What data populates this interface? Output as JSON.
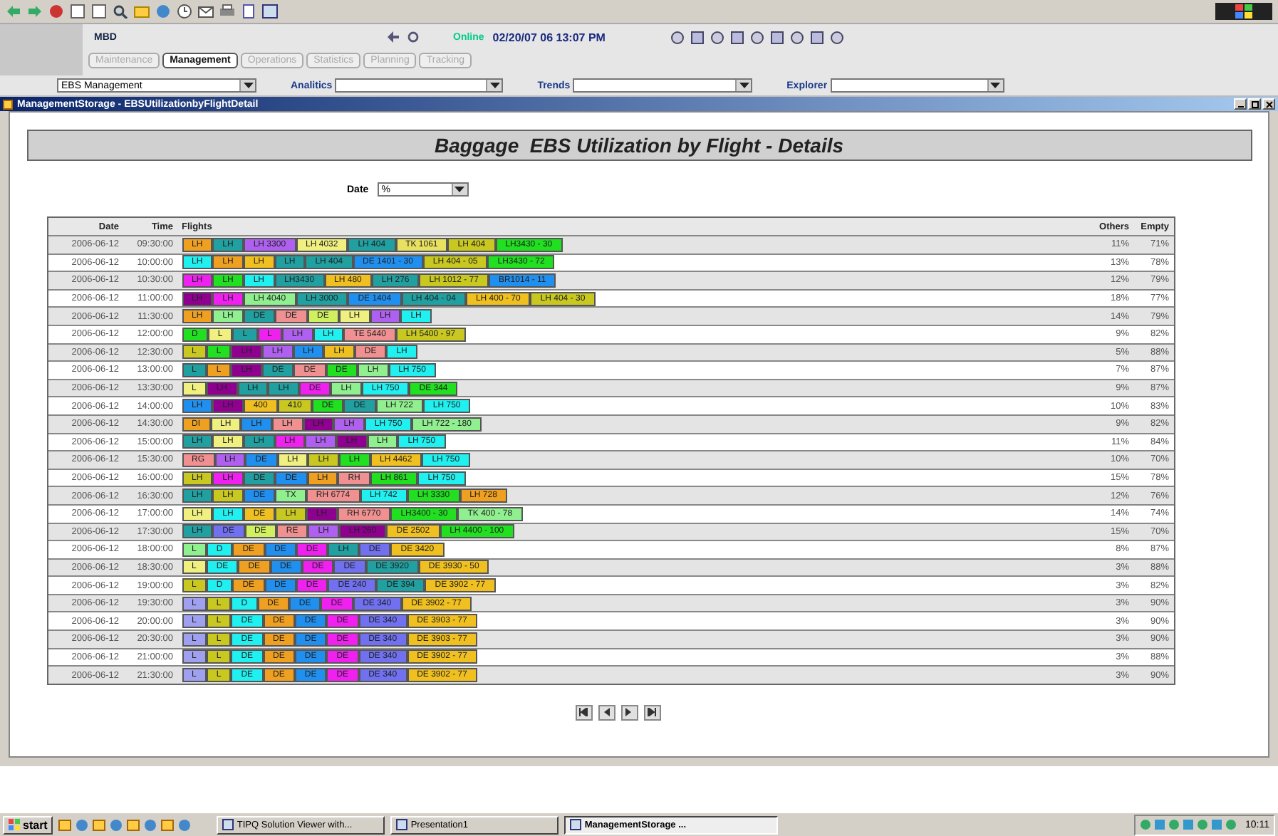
{
  "header": {
    "user": "MBD",
    "status": "Online",
    "timestamp": "02/20/07 06 13:07 PM",
    "tabs": [
      {
        "label": "Maintenance",
        "selected": false
      },
      {
        "label": "Management",
        "selected": true
      },
      {
        "label": "Operations",
        "selected": false
      },
      {
        "label": "Statistics",
        "selected": false
      },
      {
        "label": "Planning",
        "selected": false
      },
      {
        "label": "Tracking",
        "selected": false
      }
    ]
  },
  "filters": [
    {
      "value": "EBS Management"
    },
    {
      "label": "Analitics"
    },
    {
      "label": "Trends"
    },
    {
      "label": "Explorer"
    }
  ],
  "window": {
    "title": "ManagementStorage - EBSUtilizationbyFlightDetail"
  },
  "report": {
    "title": "Baggage  EBS Utilization by Flight - Details",
    "date_filter": {
      "label": "Date",
      "value": "%"
    },
    "table": {
      "columns": [
        "Date",
        "Time",
        "Flights",
        "Others",
        "Empty"
      ],
      "rows": [
        {
          "date": "2006-06-12",
          "time": "09:30:00",
          "others": "11%",
          "empty": "71%",
          "flights": [
            {
              "label": "LH",
              "color": "#f0a020"
            },
            {
              "label": "LH",
              "color": "#20a0a0"
            },
            {
              "label": "LH 3300",
              "color": "#b060f0"
            },
            {
              "label": "LH 4032",
              "color": "#f0f080"
            },
            {
              "label": "LH 404",
              "color": "#20a0a0"
            },
            {
              "label": "TK 1061",
              "color": "#e8e060"
            },
            {
              "label": "LH 404",
              "color": "#c8c820"
            },
            {
              "label": "LH3430 - 30",
              "color": "#20e020"
            }
          ]
        },
        {
          "date": "2006-06-12",
          "time": "10:00:00",
          "others": "13%",
          "empty": "78%",
          "flights": [
            {
              "label": "LH",
              "color": "#20f0f0"
            },
            {
              "label": "LH",
              "color": "#f0a020"
            },
            {
              "label": "LH",
              "color": "#f0c020"
            },
            {
              "label": "LH",
              "color": "#20a0a0"
            },
            {
              "label": "LH 404",
              "color": "#20a0a0"
            },
            {
              "label": "DE 1401 - 30",
              "color": "#2090f0"
            },
            {
              "label": "LH 404 - 05",
              "color": "#c8c820"
            },
            {
              "label": "LH3430 - 72",
              "color": "#20e020"
            }
          ]
        },
        {
          "date": "2006-06-12",
          "time": "10:30:00",
          "others": "12%",
          "empty": "79%",
          "flights": [
            {
              "label": "LH",
              "color": "#f020f0"
            },
            {
              "label": "LH",
              "color": "#20e020"
            },
            {
              "label": "LH",
              "color": "#20f0f0"
            },
            {
              "label": "LH3430",
              "color": "#20a0a0"
            },
            {
              "label": "LH 480",
              "color": "#f0c020"
            },
            {
              "label": "LH 276",
              "color": "#20a0a0"
            },
            {
              "label": "LH 1012 - 77",
              "color": "#c8c820"
            },
            {
              "label": "BR1014 - 11",
              "color": "#2090f0"
            }
          ]
        },
        {
          "date": "2006-06-12",
          "time": "11:00:00",
          "others": "18%",
          "empty": "77%",
          "flights": [
            {
              "label": "LH",
              "color": "#900090"
            },
            {
              "label": "LH",
              "color": "#f020f0"
            },
            {
              "label": "LH 4040",
              "color": "#90f090"
            },
            {
              "label": "LH 3000",
              "color": "#20a0a0"
            },
            {
              "label": "DE 1404",
              "color": "#2090f0"
            },
            {
              "label": "LH 404 - 04",
              "color": "#20a0a0"
            },
            {
              "label": "LH 400 - 70",
              "color": "#f0c020"
            },
            {
              "label": "LH 404 - 30",
              "color": "#c8c820"
            }
          ]
        },
        {
          "date": "2006-06-12",
          "time": "11:30:00",
          "others": "14%",
          "empty": "79%",
          "flights": [
            {
              "label": "LH",
              "color": "#f0a020"
            },
            {
              "label": "LH",
              "color": "#90f090"
            },
            {
              "label": "DE",
              "color": "#20a0a0"
            },
            {
              "label": "DE",
              "color": "#f09090"
            },
            {
              "label": "DE",
              "color": "#d0f060"
            },
            {
              "label": "LH",
              "color": "#f0f080"
            },
            {
              "label": "LH",
              "color": "#b060f0"
            },
            {
              "label": "LH",
              "color": "#20f0f0"
            }
          ]
        },
        {
          "date": "2006-06-12",
          "time": "12:00:00",
          "others": "9%",
          "empty": "82%",
          "flights": [
            {
              "label": "D",
              "color": "#20e020"
            },
            {
              "label": "L",
              "color": "#f0f080"
            },
            {
              "label": "L",
              "color": "#20a0a0"
            },
            {
              "label": "L",
              "color": "#f020f0"
            },
            {
              "label": "LH",
              "color": "#b060f0"
            },
            {
              "label": "LH",
              "color": "#20f0f0"
            },
            {
              "label": "TE 5440",
              "color": "#f09090"
            },
            {
              "label": "LH 5400 - 97",
              "color": "#c8c820"
            }
          ]
        },
        {
          "date": "2006-06-12",
          "time": "12:30:00",
          "others": "5%",
          "empty": "88%",
          "flights": [
            {
              "label": "L",
              "color": "#c8c820"
            },
            {
              "label": "L",
              "color": "#20e020"
            },
            {
              "label": "LH",
              "color": "#900090"
            },
            {
              "label": "LH",
              "color": "#b060f0"
            },
            {
              "label": "LH",
              "color": "#2090f0"
            },
            {
              "label": "LH",
              "color": "#f0c020"
            },
            {
              "label": "DE",
              "color": "#f09090"
            },
            {
              "label": "LH",
              "color": "#20f0f0"
            }
          ]
        },
        {
          "date": "2006-06-12",
          "time": "13:00:00",
          "others": "7%",
          "empty": "87%",
          "flights": [
            {
              "label": "L",
              "color": "#20a0a0"
            },
            {
              "label": "L",
              "color": "#f0a020"
            },
            {
              "label": "LH",
              "color": "#900090"
            },
            {
              "label": "DE",
              "color": "#20a0a0"
            },
            {
              "label": "DE",
              "color": "#f09090"
            },
            {
              "label": "DE",
              "color": "#20e020"
            },
            {
              "label": "LH",
              "color": "#90f090"
            },
            {
              "label": "LH 750",
              "color": "#20f0f0"
            }
          ]
        },
        {
          "date": "2006-06-12",
          "time": "13:30:00",
          "others": "9%",
          "empty": "87%",
          "flights": [
            {
              "label": "L",
              "color": "#f0f080"
            },
            {
              "label": "LH",
              "color": "#900090"
            },
            {
              "label": "LH",
              "color": "#20a0a0"
            },
            {
              "label": "LH",
              "color": "#20a0a0"
            },
            {
              "label": "DE",
              "color": "#f020f0"
            },
            {
              "label": "LH",
              "color": "#90f090"
            },
            {
              "label": "LH 750",
              "color": "#20f0f0"
            },
            {
              "label": "DE 344",
              "color": "#20e020"
            }
          ]
        },
        {
          "date": "2006-06-12",
          "time": "14:00:00",
          "others": "10%",
          "empty": "83%",
          "flights": [
            {
              "label": "LH",
              "color": "#2090f0"
            },
            {
              "label": "LH",
              "color": "#900090"
            },
            {
              "label": "400",
              "color": "#f0c020"
            },
            {
              "label": "410",
              "color": "#c8c820"
            },
            {
              "label": "DE",
              "color": "#20e020"
            },
            {
              "label": "DE",
              "color": "#20a0a0"
            },
            {
              "label": "LH 722",
              "color": "#90f090"
            },
            {
              "label": "LH 750",
              "color": "#20f0f0"
            }
          ]
        },
        {
          "date": "2006-06-12",
          "time": "14:30:00",
          "others": "9%",
          "empty": "82%",
          "flights": [
            {
              "label": "DI",
              "color": "#f0a020"
            },
            {
              "label": "LH",
              "color": "#f0f080"
            },
            {
              "label": "LH",
              "color": "#2090f0"
            },
            {
              "label": "LH",
              "color": "#f09090"
            },
            {
              "label": "LH",
              "color": "#900090"
            },
            {
              "label": "LH",
              "color": "#b060f0"
            },
            {
              "label": "LH 750",
              "color": "#20f0f0"
            },
            {
              "label": "LH 722 - 180",
              "color": "#90f090"
            }
          ]
        },
        {
          "date": "2006-06-12",
          "time": "15:00:00",
          "others": "11%",
          "empty": "84%",
          "flights": [
            {
              "label": "LH",
              "color": "#20a0a0"
            },
            {
              "label": "LH",
              "color": "#f0f080"
            },
            {
              "label": "LH",
              "color": "#20a0a0"
            },
            {
              "label": "LH",
              "color": "#f020f0"
            },
            {
              "label": "LH",
              "color": "#b060f0"
            },
            {
              "label": "LH",
              "color": "#900090"
            },
            {
              "label": "LH",
              "color": "#90f090"
            },
            {
              "label": "LH 750",
              "color": "#20f0f0"
            }
          ]
        },
        {
          "date": "2006-06-12",
          "time": "15:30:00",
          "others": "10%",
          "empty": "70%",
          "flights": [
            {
              "label": "RG",
              "color": "#f09090"
            },
            {
              "label": "LH",
              "color": "#b060f0"
            },
            {
              "label": "DE",
              "color": "#2090f0"
            },
            {
              "label": "LH",
              "color": "#f0f080"
            },
            {
              "label": "LH",
              "color": "#c8c820"
            },
            {
              "label": "LH",
              "color": "#20e020"
            },
            {
              "label": "LH 4462",
              "color": "#f0c020"
            },
            {
              "label": "LH 750",
              "color": "#20f0f0"
            }
          ]
        },
        {
          "date": "2006-06-12",
          "time": "16:00:00",
          "others": "15%",
          "empty": "78%",
          "flights": [
            {
              "label": "LH",
              "color": "#c8c820"
            },
            {
              "label": "LH",
              "color": "#f020f0"
            },
            {
              "label": "DE",
              "color": "#20a0a0"
            },
            {
              "label": "DE",
              "color": "#2090f0"
            },
            {
              "label": "LH",
              "color": "#f0a020"
            },
            {
              "label": "RH",
              "color": "#f09090"
            },
            {
              "label": "LH 861",
              "color": "#20e020"
            },
            {
              "label": "LH 750",
              "color": "#20f0f0"
            }
          ]
        },
        {
          "date": "2006-06-12",
          "time": "16:30:00",
          "others": "12%",
          "empty": "76%",
          "flights": [
            {
              "label": "LH",
              "color": "#20a0a0"
            },
            {
              "label": "LH",
              "color": "#c8c820"
            },
            {
              "label": "DE",
              "color": "#2090f0"
            },
            {
              "label": "TX",
              "color": "#90f090"
            },
            {
              "label": "RH 6774",
              "color": "#f09090"
            },
            {
              "label": "LH 742",
              "color": "#20f0f0"
            },
            {
              "label": "LH 3330",
              "color": "#20e020"
            },
            {
              "label": "LH 728",
              "color": "#f0a020"
            }
          ]
        },
        {
          "date": "2006-06-12",
          "time": "17:00:00",
          "others": "14%",
          "empty": "74%",
          "flights": [
            {
              "label": "LH",
              "color": "#f0f080"
            },
            {
              "label": "LH",
              "color": "#20f0f0"
            },
            {
              "label": "DE",
              "color": "#f0c020"
            },
            {
              "label": "LH",
              "color": "#c8c820"
            },
            {
              "label": "LH",
              "color": "#900090"
            },
            {
              "label": "RH 6770",
              "color": "#f09090"
            },
            {
              "label": "LH3400 - 30",
              "color": "#20e020"
            },
            {
              "label": "TK 400 - 78",
              "color": "#90f090"
            }
          ]
        },
        {
          "date": "2006-06-12",
          "time": "17:30:00",
          "others": "15%",
          "empty": "70%",
          "flights": [
            {
              "label": "LH",
              "color": "#20a0a0"
            },
            {
              "label": "DE",
              "color": "#7070f0"
            },
            {
              "label": "DE",
              "color": "#d0f060"
            },
            {
              "label": "RE",
              "color": "#f09090"
            },
            {
              "label": "LH",
              "color": "#b060f0"
            },
            {
              "label": "LH 260",
              "color": "#900090"
            },
            {
              "label": "DE 2502",
              "color": "#f0c020"
            },
            {
              "label": "LH 4400 - 100",
              "color": "#20e020"
            }
          ]
        },
        {
          "date": "2006-06-12",
          "time": "18:00:00",
          "others": "8%",
          "empty": "87%",
          "flights": [
            {
              "label": "L",
              "color": "#90f090"
            },
            {
              "label": "D",
              "color": "#20f0f0"
            },
            {
              "label": "DE",
              "color": "#f0a020"
            },
            {
              "label": "DE",
              "color": "#2090f0"
            },
            {
              "label": "DE",
              "color": "#f020f0"
            },
            {
              "label": "LH",
              "color": "#20a0a0"
            },
            {
              "label": "DE",
              "color": "#7070f0"
            },
            {
              "label": "DE 3420",
              "color": "#f0c020"
            }
          ]
        },
        {
          "date": "2006-06-12",
          "time": "18:30:00",
          "others": "3%",
          "empty": "88%",
          "flights": [
            {
              "label": "L",
              "color": "#f0f080"
            },
            {
              "label": "DE",
              "color": "#20f0f0"
            },
            {
              "label": "DE",
              "color": "#f0a020"
            },
            {
              "label": "DE",
              "color": "#2090f0"
            },
            {
              "label": "DE",
              "color": "#f020f0"
            },
            {
              "label": "DE",
              "color": "#7070f0"
            },
            {
              "label": "DE 3920",
              "color": "#20a0a0"
            },
            {
              "label": "DE 3930 - 50",
              "color": "#f0c020"
            }
          ]
        },
        {
          "date": "2006-06-12",
          "time": "19:00:00",
          "others": "3%",
          "empty": "82%",
          "flights": [
            {
              "label": "L",
              "color": "#c8c820"
            },
            {
              "label": "D",
              "color": "#20f0f0"
            },
            {
              "label": "DE",
              "color": "#f0a020"
            },
            {
              "label": "DE",
              "color": "#2090f0"
            },
            {
              "label": "DE",
              "color": "#f020f0"
            },
            {
              "label": "DE 240",
              "color": "#7070f0"
            },
            {
              "label": "DE 394",
              "color": "#20a0a0"
            },
            {
              "label": "DE 3902 - 77",
              "color": "#f0c020"
            }
          ]
        },
        {
          "date": "2006-06-12",
          "time": "19:30:00",
          "others": "3%",
          "empty": "90%",
          "flights": [
            {
              "label": "L",
              "color": "#a0a0f0"
            },
            {
              "label": "L",
              "color": "#c8c820"
            },
            {
              "label": "D",
              "color": "#20f0f0"
            },
            {
              "label": "DE",
              "color": "#f0a020"
            },
            {
              "label": "DE",
              "color": "#2090f0"
            },
            {
              "label": "DE",
              "color": "#f020f0"
            },
            {
              "label": "DE 340",
              "color": "#7070f0"
            },
            {
              "label": "DE 3902 - 77",
              "color": "#f0c020"
            }
          ]
        },
        {
          "date": "2006-06-12",
          "time": "20:00:00",
          "others": "3%",
          "empty": "90%",
          "flights": [
            {
              "label": "L",
              "color": "#a0a0f0"
            },
            {
              "label": "L",
              "color": "#c8c820"
            },
            {
              "label": "DE",
              "color": "#20f0f0"
            },
            {
              "label": "DE",
              "color": "#f0a020"
            },
            {
              "label": "DE",
              "color": "#2090f0"
            },
            {
              "label": "DE",
              "color": "#f020f0"
            },
            {
              "label": "DE 340",
              "color": "#7070f0"
            },
            {
              "label": "DE 3903 - 77",
              "color": "#f0c020"
            }
          ]
        },
        {
          "date": "2006-06-12",
          "time": "20:30:00",
          "others": "3%",
          "empty": "90%",
          "flights": [
            {
              "label": "L",
              "color": "#a0a0f0"
            },
            {
              "label": "L",
              "color": "#c8c820"
            },
            {
              "label": "DE",
              "color": "#20f0f0"
            },
            {
              "label": "DE",
              "color": "#f0a020"
            },
            {
              "label": "DE",
              "color": "#2090f0"
            },
            {
              "label": "DE",
              "color": "#f020f0"
            },
            {
              "label": "DE 340",
              "color": "#7070f0"
            },
            {
              "label": "DE 3903 - 77",
              "color": "#f0c020"
            }
          ]
        },
        {
          "date": "2006-06-12",
          "time": "21:00:00",
          "others": "3%",
          "empty": "88%",
          "flights": [
            {
              "label": "L",
              "color": "#a0a0f0"
            },
            {
              "label": "L",
              "color": "#c8c820"
            },
            {
              "label": "DE",
              "color": "#20f0f0"
            },
            {
              "label": "DE",
              "color": "#f0a020"
            },
            {
              "label": "DE",
              "color": "#2090f0"
            },
            {
              "label": "DE",
              "color": "#f020f0"
            },
            {
              "label": "DE 340",
              "color": "#7070f0"
            },
            {
              "label": "DE 3902 - 77",
              "color": "#f0c020"
            }
          ]
        },
        {
          "date": "2006-06-12",
          "time": "21:30:00",
          "others": "3%",
          "empty": "90%",
          "flights": [
            {
              "label": "L",
              "color": "#a0a0f0"
            },
            {
              "label": "L",
              "color": "#c8c820"
            },
            {
              "label": "DE",
              "color": "#20f0f0"
            },
            {
              "label": "DE",
              "color": "#f0a020"
            },
            {
              "label": "DE",
              "color": "#2090f0"
            },
            {
              "label": "DE",
              "color": "#f020f0"
            },
            {
              "label": "DE 340",
              "color": "#7070f0"
            },
            {
              "label": "DE 3902 - 77",
              "color": "#f0c020"
            }
          ]
        }
      ]
    }
  },
  "taskbar": {
    "start": "start",
    "tasks": [
      {
        "label": "TIPQ Solution Viewer with...",
        "selected": false
      },
      {
        "label": "Presentation1",
        "selected": false
      },
      {
        "label": "ManagementStorage ...",
        "selected": true
      }
    ],
    "clock": "10:11"
  }
}
